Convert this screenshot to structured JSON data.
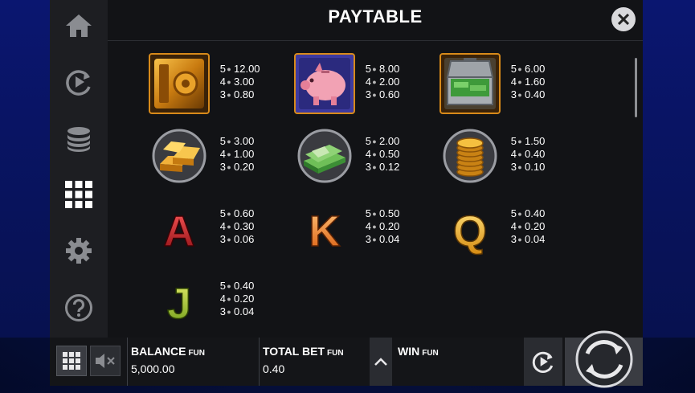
{
  "header": {
    "title": "PAYTABLE"
  },
  "symbols": [
    {
      "name": "safe",
      "pays": [
        {
          "n": "5",
          "v": "12.00"
        },
        {
          "n": "4",
          "v": "3.00"
        },
        {
          "n": "3",
          "v": "0.80"
        }
      ]
    },
    {
      "name": "piggy-bank",
      "pays": [
        {
          "n": "5",
          "v": "8.00"
        },
        {
          "n": "4",
          "v": "2.00"
        },
        {
          "n": "3",
          "v": "0.60"
        }
      ]
    },
    {
      "name": "briefcase-of-money",
      "pays": [
        {
          "n": "5",
          "v": "6.00"
        },
        {
          "n": "4",
          "v": "1.60"
        },
        {
          "n": "3",
          "v": "0.40"
        }
      ]
    },
    {
      "name": "gold-bars",
      "pays": [
        {
          "n": "5",
          "v": "3.00"
        },
        {
          "n": "4",
          "v": "1.00"
        },
        {
          "n": "3",
          "v": "0.20"
        }
      ]
    },
    {
      "name": "cash-stack",
      "pays": [
        {
          "n": "5",
          "v": "2.00"
        },
        {
          "n": "4",
          "v": "0.50"
        },
        {
          "n": "3",
          "v": "0.12"
        }
      ]
    },
    {
      "name": "coin-stack",
      "pays": [
        {
          "n": "5",
          "v": "1.50"
        },
        {
          "n": "4",
          "v": "0.40"
        },
        {
          "n": "3",
          "v": "0.10"
        }
      ]
    },
    {
      "name": "letter-a",
      "letter": "A",
      "pays": [
        {
          "n": "5",
          "v": "0.60"
        },
        {
          "n": "4",
          "v": "0.30"
        },
        {
          "n": "3",
          "v": "0.06"
        }
      ]
    },
    {
      "name": "letter-k",
      "letter": "K",
      "pays": [
        {
          "n": "5",
          "v": "0.50"
        },
        {
          "n": "4",
          "v": "0.20"
        },
        {
          "n": "3",
          "v": "0.04"
        }
      ]
    },
    {
      "name": "letter-q",
      "letter": "Q",
      "pays": [
        {
          "n": "5",
          "v": "0.40"
        },
        {
          "n": "4",
          "v": "0.20"
        },
        {
          "n": "3",
          "v": "0.04"
        }
      ]
    },
    {
      "name": "letter-j",
      "letter": "J",
      "pays": [
        {
          "n": "5",
          "v": "0.40"
        },
        {
          "n": "4",
          "v": "0.20"
        },
        {
          "n": "3",
          "v": "0.04"
        }
      ]
    }
  ],
  "footer": {
    "balance_label": "BALANCE",
    "balance_currency": "FUN",
    "balance_value": "5,000.00",
    "total_bet_label": "TOTAL BET",
    "total_bet_currency": "FUN",
    "total_bet_value": "0.40",
    "win_label": "WIN",
    "win_currency": "FUN"
  },
  "icons": {
    "sidebar": [
      "home-icon",
      "autoplay-icon",
      "coins-icon",
      "paytable-grid-icon",
      "settings-gear-icon",
      "help-icon"
    ],
    "close": "close-icon",
    "footer": [
      "menu-grid-icon",
      "sound-muted-icon",
      "bet-up-chevron-icon",
      "autoplay-icon",
      "spin-icon"
    ]
  },
  "colors": {
    "panel_bg": "#121316",
    "sidebar_bg": "#1d1e22",
    "text": "#ffffff",
    "active_icon": "#ffffff",
    "inactive_icon": "#8a8c91"
  }
}
